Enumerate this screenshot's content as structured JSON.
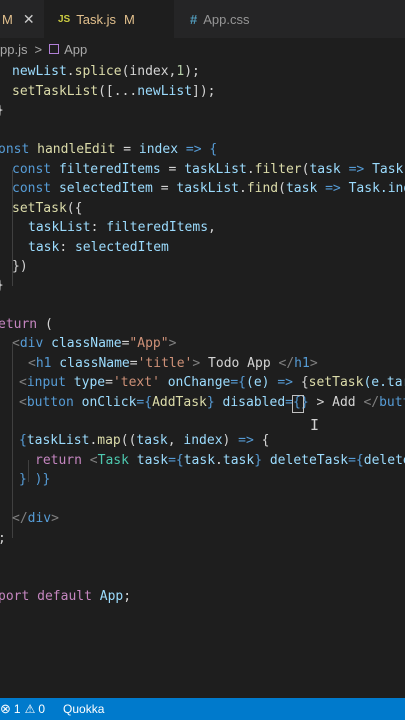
{
  "tabs": [
    {
      "label": "M",
      "active": false
    },
    {
      "icon": "JS",
      "label": "Task.js",
      "modified": "M",
      "active": true
    },
    {
      "icon": "#",
      "label": "App.css",
      "active": false
    }
  ],
  "breadcrumb": {
    "file": "pp.js",
    "separator": ">",
    "symbol": "App"
  },
  "code": {
    "l1": {
      "a": "newList",
      "b": ".",
      "c": "splice",
      "d": "(index,",
      "e": "1",
      "f": ");"
    },
    "l2": {
      "a": "setTaskList",
      "b": "([...",
      "c": "newList",
      "d": "]);"
    },
    "l4": {
      "a": "onst",
      "b": "handleEdit",
      "c": " = ",
      "d": "index",
      "e": " => {"
    },
    "l5": {
      "a": "const",
      "b": "filteredItems",
      "c": " = ",
      "d": "taskList",
      "e": ".",
      "f": "filter",
      "g": "(",
      "h": "task",
      "i": " => ",
      "j": "Task."
    },
    "l6": {
      "a": "const",
      "b": "selectedItem",
      "c": " = ",
      "d": "taskList",
      "e": ".",
      "f": "find",
      "g": "(",
      "h": "task",
      "i": " => ",
      "j": "Task.ind"
    },
    "l7": {
      "a": "setTask",
      "b": "({"
    },
    "l8": {
      "a": "taskList",
      "b": ": ",
      "c": "filteredItems",
      "d": ","
    },
    "l9": {
      "a": "task",
      "b": ": ",
      "c": "selectedItem"
    },
    "l10": {
      "a": "})"
    },
    "l11": {
      "a": "}"
    },
    "l13": {
      "a": "eturn",
      "b": " ("
    },
    "l14": {
      "a": "<",
      "b": "div",
      "c": " className",
      "d": "=",
      "e": "\"App\"",
      "f": ">"
    },
    "l15": {
      "a": "<",
      "b": "h1",
      "c": " className",
      "d": "=",
      "e": "'title'",
      "f": ">",
      "g": " Todo App ",
      "h": "</",
      "i": "h1",
      "j": ">"
    },
    "l16": {
      "a": "<",
      "b": "input",
      "c": " type",
      "d": "=",
      "e": "'text'",
      "f": " onChange",
      "g": "={",
      "h": "(e)",
      "i": " => ",
      "j": "{",
      "k": "setTask",
      "l": "(e.tar"
    },
    "l17": {
      "a": "<",
      "b": "button",
      "c": " onClick",
      "d": "={",
      "e": "AddTask",
      "f": "}",
      "g": " disabled",
      "h": "={",
      "i": "}",
      "j": " > Add ",
      "k": "</",
      "l": "butt"
    },
    "l19": {
      "a": "{",
      "b": "taskList",
      "c": ".",
      "d": "map",
      "e": "((",
      "f": "task",
      "g": ", ",
      "h": "index",
      "i": ")",
      "j": " => ",
      "k": "{"
    },
    "l20": {
      "a": "return",
      "b": " <",
      "c": "Task",
      "d": " task",
      "e": "={",
      "f": "task",
      "g": ".",
      "h": "task",
      "i": "}",
      "j": " deleteTask",
      "k": "={",
      "l": "delete"
    },
    "l21": {
      "a": "} )}"
    },
    "l23": {
      "a": "</",
      "b": "div",
      "c": ">"
    },
    "l24": {
      "a": ";"
    },
    "l27": {
      "a": "port",
      "b": " default",
      "c": " App",
      "d": ";"
    }
  },
  "status": {
    "a": "1",
    "b": "0",
    "c": "Quokka"
  },
  "colors": {
    "accent": "#007acc",
    "background": "#1e1e1e",
    "modified": "#e2c08d"
  }
}
